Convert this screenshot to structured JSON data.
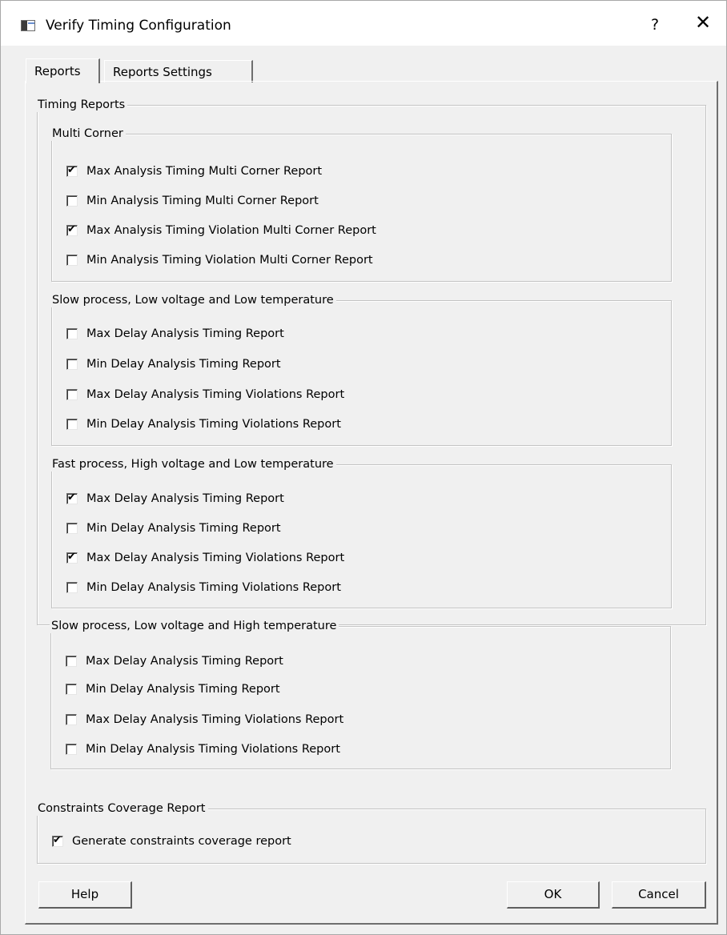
{
  "window": {
    "title": "Verify Timing Configuration",
    "help_label": "?",
    "close_label": "✕"
  },
  "tabs": [
    {
      "label": "Reports",
      "active": true
    },
    {
      "label": "Reports Settings",
      "active": false
    }
  ],
  "timing_reports": {
    "title": "Timing Reports",
    "groups": [
      {
        "title": "Multi Corner",
        "items": [
          {
            "label": "Max Analysis Timing Multi Corner Report",
            "checked": true
          },
          {
            "label": "Min Analysis Timing Multi Corner Report",
            "checked": false
          },
          {
            "label": "Max Analysis Timing Violation Multi Corner Report",
            "checked": true
          },
          {
            "label": "Min Analysis Timing Violation Multi Corner Report",
            "checked": false
          }
        ]
      },
      {
        "title": "Slow process, Low voltage and Low temperature",
        "items": [
          {
            "label": "Max Delay Analysis Timing Report",
            "checked": false
          },
          {
            "label": "Min Delay Analysis Timing Report",
            "checked": false
          },
          {
            "label": "Max Delay Analysis Timing Violations Report",
            "checked": false
          },
          {
            "label": "Min Delay Analysis Timing Violations Report",
            "checked": false
          }
        ]
      },
      {
        "title": "Fast process, High voltage and Low temperature",
        "items": [
          {
            "label": "Max Delay Analysis Timing Report",
            "checked": true
          },
          {
            "label": "Min Delay Analysis Timing Report",
            "checked": false
          },
          {
            "label": "Max Delay Analysis Timing Violations Report",
            "checked": true
          },
          {
            "label": "Min Delay Analysis Timing Violations Report",
            "checked": false
          }
        ]
      },
      {
        "title": "Slow process, Low voltage and High temperature",
        "items": [
          {
            "label": "Max Delay Analysis Timing Report",
            "checked": false
          },
          {
            "label": "Min Delay Analysis Timing Report",
            "checked": false
          },
          {
            "label": "Max Delay Analysis Timing Violations Report",
            "checked": false
          },
          {
            "label": "Min Delay Analysis Timing Violations Report",
            "checked": false
          }
        ]
      }
    ]
  },
  "coverage": {
    "title": "Constraints Coverage Report",
    "item": {
      "label": "Generate constraints coverage report",
      "checked": true
    }
  },
  "buttons": {
    "help": "Help",
    "ok": "OK",
    "cancel": "Cancel"
  },
  "checkmark_glyph": "✔"
}
